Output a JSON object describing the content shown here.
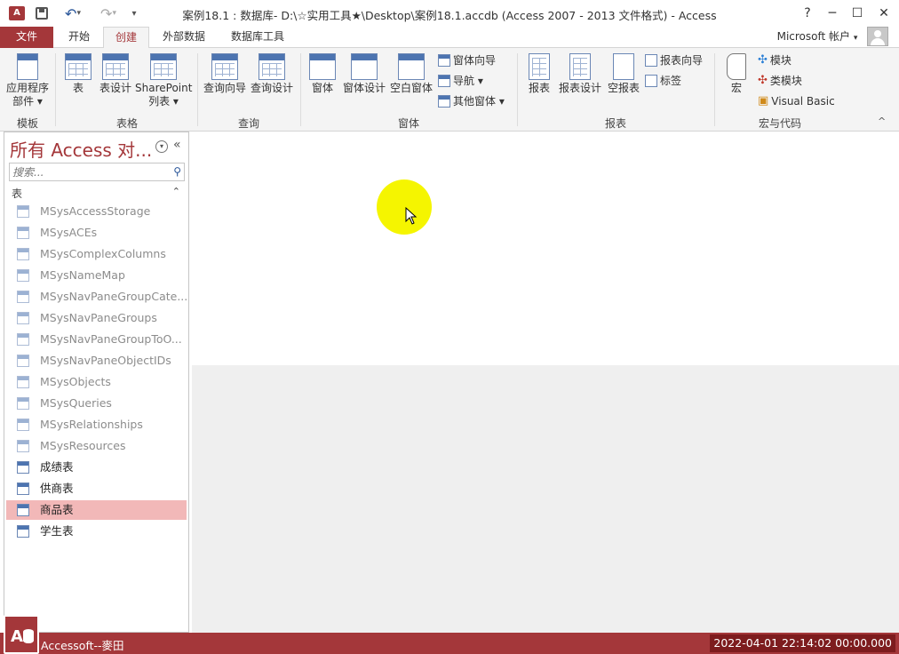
{
  "window": {
    "title": "案例18.1 : 数据库- D:\\☆实用工具★\\Desktop\\案例18.1.accdb (Access 2007 - 2013 文件格式) - Access",
    "help": "?",
    "minimize": "─",
    "maximize": "☐",
    "close": "✕"
  },
  "qat": {
    "save": "💾",
    "undo": "↶",
    "redo": "↷",
    "more": "▾"
  },
  "tabs": [
    {
      "label": "文件"
    },
    {
      "label": "开始"
    },
    {
      "label": "创建"
    },
    {
      "label": "外部数据"
    },
    {
      "label": "数据库工具"
    }
  ],
  "account": {
    "label": "Microsoft 帐户",
    "arrow": "▾"
  },
  "ribbon": {
    "groups": [
      {
        "label": "模板"
      },
      {
        "label": "表格"
      },
      {
        "label": "查询"
      },
      {
        "label": "窗体"
      },
      {
        "label": "报表"
      },
      {
        "label": "宏与代码"
      }
    ],
    "templates": {
      "app_parts_1": "应用程序",
      "app_parts_2": "部件 ▾"
    },
    "tables": {
      "table": "表",
      "table_design": "表设计",
      "sharepoint_1": "SharePoint",
      "sharepoint_2": "列表 ▾"
    },
    "queries": {
      "wizard": "查询向导",
      "design": "查询设计"
    },
    "forms": {
      "form": "窗体",
      "form_design": "窗体设计",
      "blank_form": "空白窗体",
      "form_wizard": "窗体向导",
      "navigation": "导航 ▾",
      "more_forms": "其他窗体 ▾"
    },
    "reports": {
      "report": "报表",
      "report_design": "报表设计",
      "blank_report": "空报表",
      "report_wizard": "报表向导",
      "labels": "标签"
    },
    "macros": {
      "macro": "宏",
      "module": "模块",
      "class_module": "类模块",
      "vba": "Visual Basic"
    },
    "collapse": "^"
  },
  "nav": {
    "title": "所有 Access 对...",
    "title_menu": "⊙",
    "collapse": "«",
    "search_placeholder": "搜索...",
    "section_label": "表",
    "section_toggle": "⌃",
    "items": [
      {
        "label": "MSysAccessStorage",
        "system": true
      },
      {
        "label": "MSysACEs",
        "system": true
      },
      {
        "label": "MSysComplexColumns",
        "system": true
      },
      {
        "label": "MSysNameMap",
        "system": true
      },
      {
        "label": "MSysNavPaneGroupCate...",
        "system": true
      },
      {
        "label": "MSysNavPaneGroups",
        "system": true
      },
      {
        "label": "MSysNavPaneGroupToO...",
        "system": true
      },
      {
        "label": "MSysNavPaneObjectIDs",
        "system": true
      },
      {
        "label": "MSysObjects",
        "system": true
      },
      {
        "label": "MSysQueries",
        "system": true
      },
      {
        "label": "MSysRelationships",
        "system": true
      },
      {
        "label": "MSysResources",
        "system": true
      },
      {
        "label": "成绩表",
        "system": false
      },
      {
        "label": "供商表",
        "system": false
      },
      {
        "label": "商品表",
        "system": false,
        "selected": true
      },
      {
        "label": "学生表",
        "system": false
      }
    ]
  },
  "status": {
    "text": "Accessoft--麥田",
    "datetime": "2022-04-01 22:14:02 00:00.000"
  },
  "colors": {
    "accent": "#a4373a",
    "cursor_highlight": "#f5f500"
  }
}
